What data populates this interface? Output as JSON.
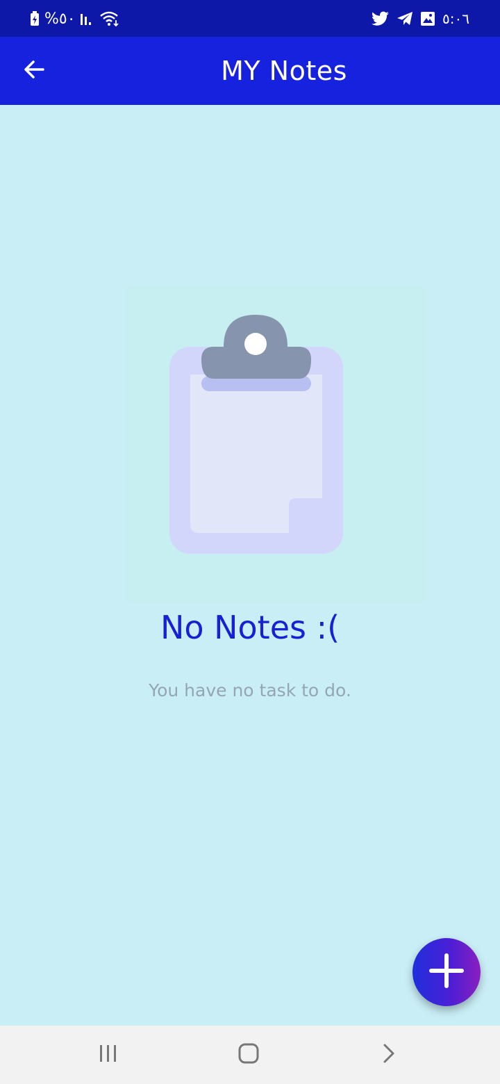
{
  "status_bar": {
    "battery_percent": "%٥٠",
    "time": "٥:٠٦",
    "icons": [
      "battery-charging-icon",
      "signal-icon",
      "wifi-icon",
      "twitter-icon",
      "telegram-icon",
      "gallery-icon"
    ]
  },
  "app_bar": {
    "title": "MY Notes",
    "back_icon": "arrow-left-icon"
  },
  "empty_state": {
    "illustration_icon": "clipboard-icon",
    "title": "No Notes :(",
    "subtitle": "You have no task to do."
  },
  "fab": {
    "icon": "plus-icon"
  },
  "nav_bar": {
    "icons": [
      "recent-apps-icon",
      "home-icon",
      "back-chevron-icon"
    ]
  },
  "colors": {
    "status_bar": "#0d17a8",
    "app_bar": "#1622dd",
    "background": "#caeef6",
    "accent": "#1620d4",
    "subtitle": "#94a6b2",
    "nav_bar": "#f2f2f2"
  }
}
